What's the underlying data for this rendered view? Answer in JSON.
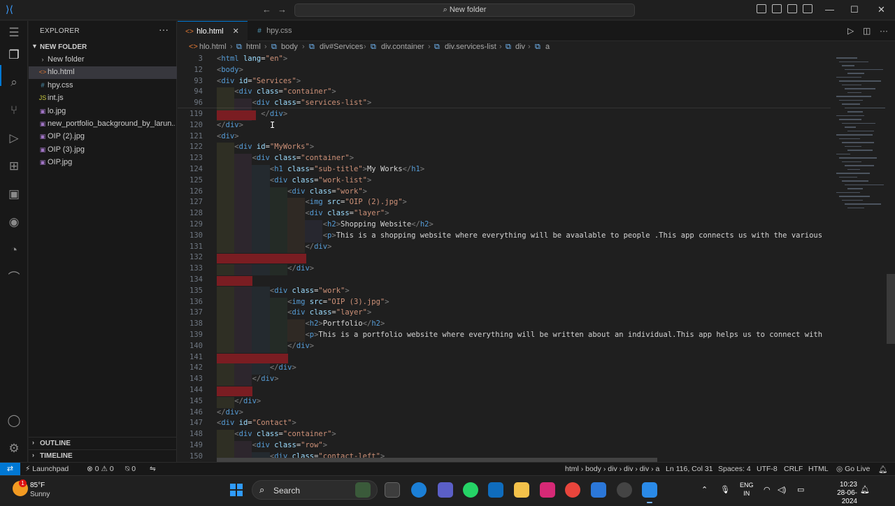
{
  "titlebar": {
    "search_text": "New folder",
    "back_icon": "arrow-left-icon",
    "forward_icon": "arrow-right-icon"
  },
  "sidebar": {
    "title": "EXPLORER",
    "more": "···",
    "folder": "NEW FOLDER",
    "files": [
      {
        "name": "New folder",
        "type": "folder"
      },
      {
        "name": "hlo.html",
        "type": "html"
      },
      {
        "name": "hpy.css",
        "type": "css"
      },
      {
        "name": "int.js",
        "type": "js"
      },
      {
        "name": "lo.jpg",
        "type": "image"
      },
      {
        "name": "new_portfolio_background_by_larun...",
        "type": "image"
      },
      {
        "name": "OIP (2).jpg",
        "type": "image"
      },
      {
        "name": "OIP (3).jpg",
        "type": "image"
      },
      {
        "name": "OIP.jpg",
        "type": "image"
      }
    ],
    "outline": "OUTLINE",
    "timeline": "TIMELINE"
  },
  "tabs": [
    {
      "label": "hlo.html",
      "active": true
    },
    {
      "label": "hpy.css",
      "active": false
    }
  ],
  "breadcrumb": [
    "hlo.html",
    "html",
    "body",
    "div#Services",
    "div.container",
    "div.services-list",
    "div",
    "a"
  ],
  "editor": {
    "lines": [
      {
        "n": "3",
        "code": "<html lang=\"en\">"
      },
      {
        "n": "12",
        "code": "<body>"
      },
      {
        "n": "93",
        "code": "<div id=\"Services\">"
      },
      {
        "n": "94",
        "code": "    <div class=\"container\">"
      },
      {
        "n": "96",
        "code": "        <div class=\"services-list\">"
      },
      {
        "n": "119",
        "code": "          </div>"
      },
      {
        "n": "120",
        "code": "</div>"
      },
      {
        "n": "121",
        "code": "<div>"
      },
      {
        "n": "122",
        "code": "    <div id=\"MyWorks\">"
      },
      {
        "n": "123",
        "code": "        <div class=\"container\">"
      },
      {
        "n": "124",
        "code": "            <h1 class=\"sub-title\">My Works</h1>"
      },
      {
        "n": "125",
        "code": "            <div class=\"work-list\">"
      },
      {
        "n": "126",
        "code": "                <div class=\"work\">"
      },
      {
        "n": "127",
        "code": "                    <img src=\"OIP (2).jpg\">"
      },
      {
        "n": "128",
        "code": "                    <div class=\"layer\">"
      },
      {
        "n": "129",
        "code": "                        <h2>Shopping Website</h2>"
      },
      {
        "n": "130",
        "code": "                        <p>This is a shopping website where everything will be avaalable to people .This app connects us with the various"
      },
      {
        "n": "131",
        "code": "                    </div>"
      },
      {
        "n": "132",
        "code": ""
      },
      {
        "n": "133",
        "code": "                </div>"
      },
      {
        "n": "134",
        "code": ""
      },
      {
        "n": "135",
        "code": "            <div class=\"work\">"
      },
      {
        "n": "136",
        "code": "                <img src=\"OIP (3).jpg\">"
      },
      {
        "n": "137",
        "code": "                <div class=\"layer\">"
      },
      {
        "n": "138",
        "code": "                    <h2>Portfolio</h2>"
      },
      {
        "n": "139",
        "code": "                    <p>This is a portfolio website where everything will be written about an individual.This app helps us to connect with"
      },
      {
        "n": "140",
        "code": "                </div>"
      },
      {
        "n": "141",
        "code": ""
      },
      {
        "n": "142",
        "code": "            </div>"
      },
      {
        "n": "143",
        "code": "        </div>"
      },
      {
        "n": "144",
        "code": ""
      },
      {
        "n": "145",
        "code": "    </div>"
      },
      {
        "n": "146",
        "code": "</div>"
      },
      {
        "n": "147",
        "code": "<div id=\"Contact\">"
      },
      {
        "n": "148",
        "code": "    <div class=\"container\">"
      },
      {
        "n": "149",
        "code": "        <div class=\"row\">"
      },
      {
        "n": "150",
        "code": "            <div class=\"contact-left\">"
      }
    ]
  },
  "status": {
    "launchpad": "Launchpad",
    "errors": "0",
    "warnings": "0",
    "ports": "0",
    "path": "html › body › div › div › div › a",
    "position": "Ln 116, Col 31",
    "spaces": "Spaces: 4",
    "encoding": "UTF-8",
    "eol": "CRLF",
    "language": "HTML",
    "golive": "Go Live"
  },
  "taskbar": {
    "temp": "85°F",
    "condition": "Sunny",
    "badge": "1",
    "search": "Search",
    "lang_top": "ENG",
    "lang_bottom": "IN",
    "time": "10:23",
    "date": "28-06-2024"
  },
  "colors": {
    "accent": "#0078d4",
    "error_bg": "#7a1d22",
    "tag": "#569cd6",
    "attribute": "#9cdcfe",
    "string": "#ce9178"
  }
}
